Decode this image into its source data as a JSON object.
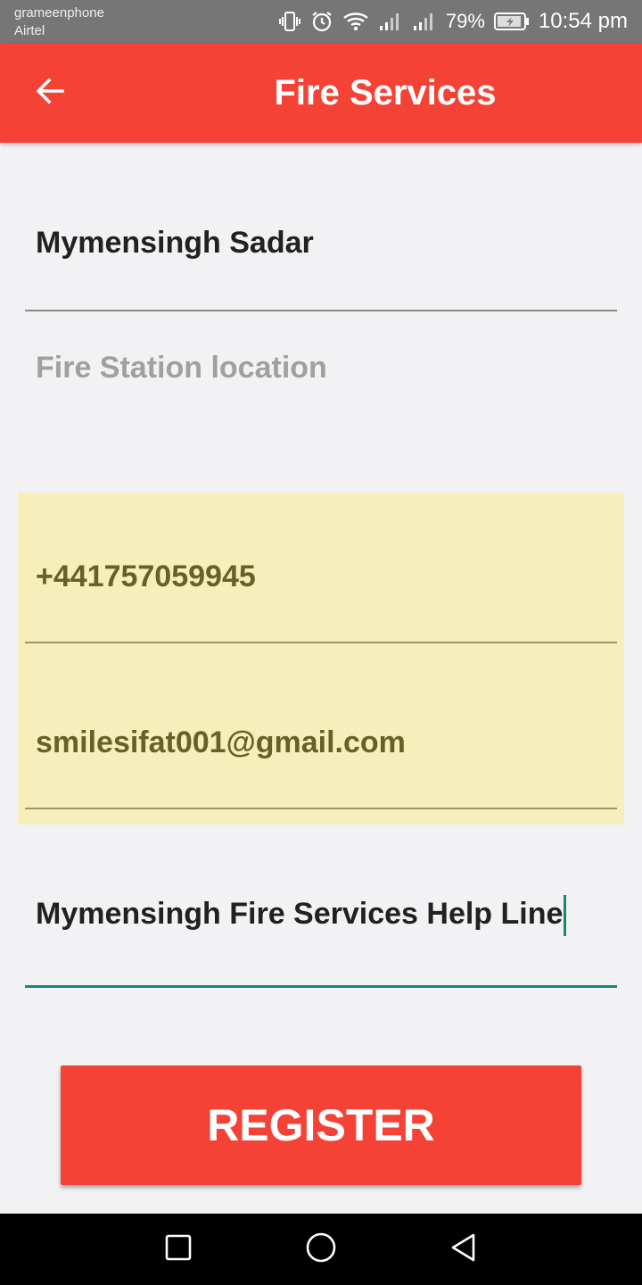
{
  "status_bar": {
    "carrier_1": "grameenphone",
    "carrier_2": "Airtel",
    "battery_percent": "79%",
    "time": "10:54 pm"
  },
  "app_bar": {
    "title": "Fire Services",
    "back_icon": "arrow-left-icon"
  },
  "form": {
    "area_value": "Mymensingh Sadar",
    "location_placeholder": "Fire Station location",
    "phone_value": "+441757059945",
    "email_value": "smilesifat001@gmail.com",
    "name_value": "Mymensingh Fire Services Help Line"
  },
  "register_label": "REGISTER",
  "colors": {
    "accent": "#f44336",
    "autofill_bg": "#f6efbb",
    "focus": "#188578"
  }
}
